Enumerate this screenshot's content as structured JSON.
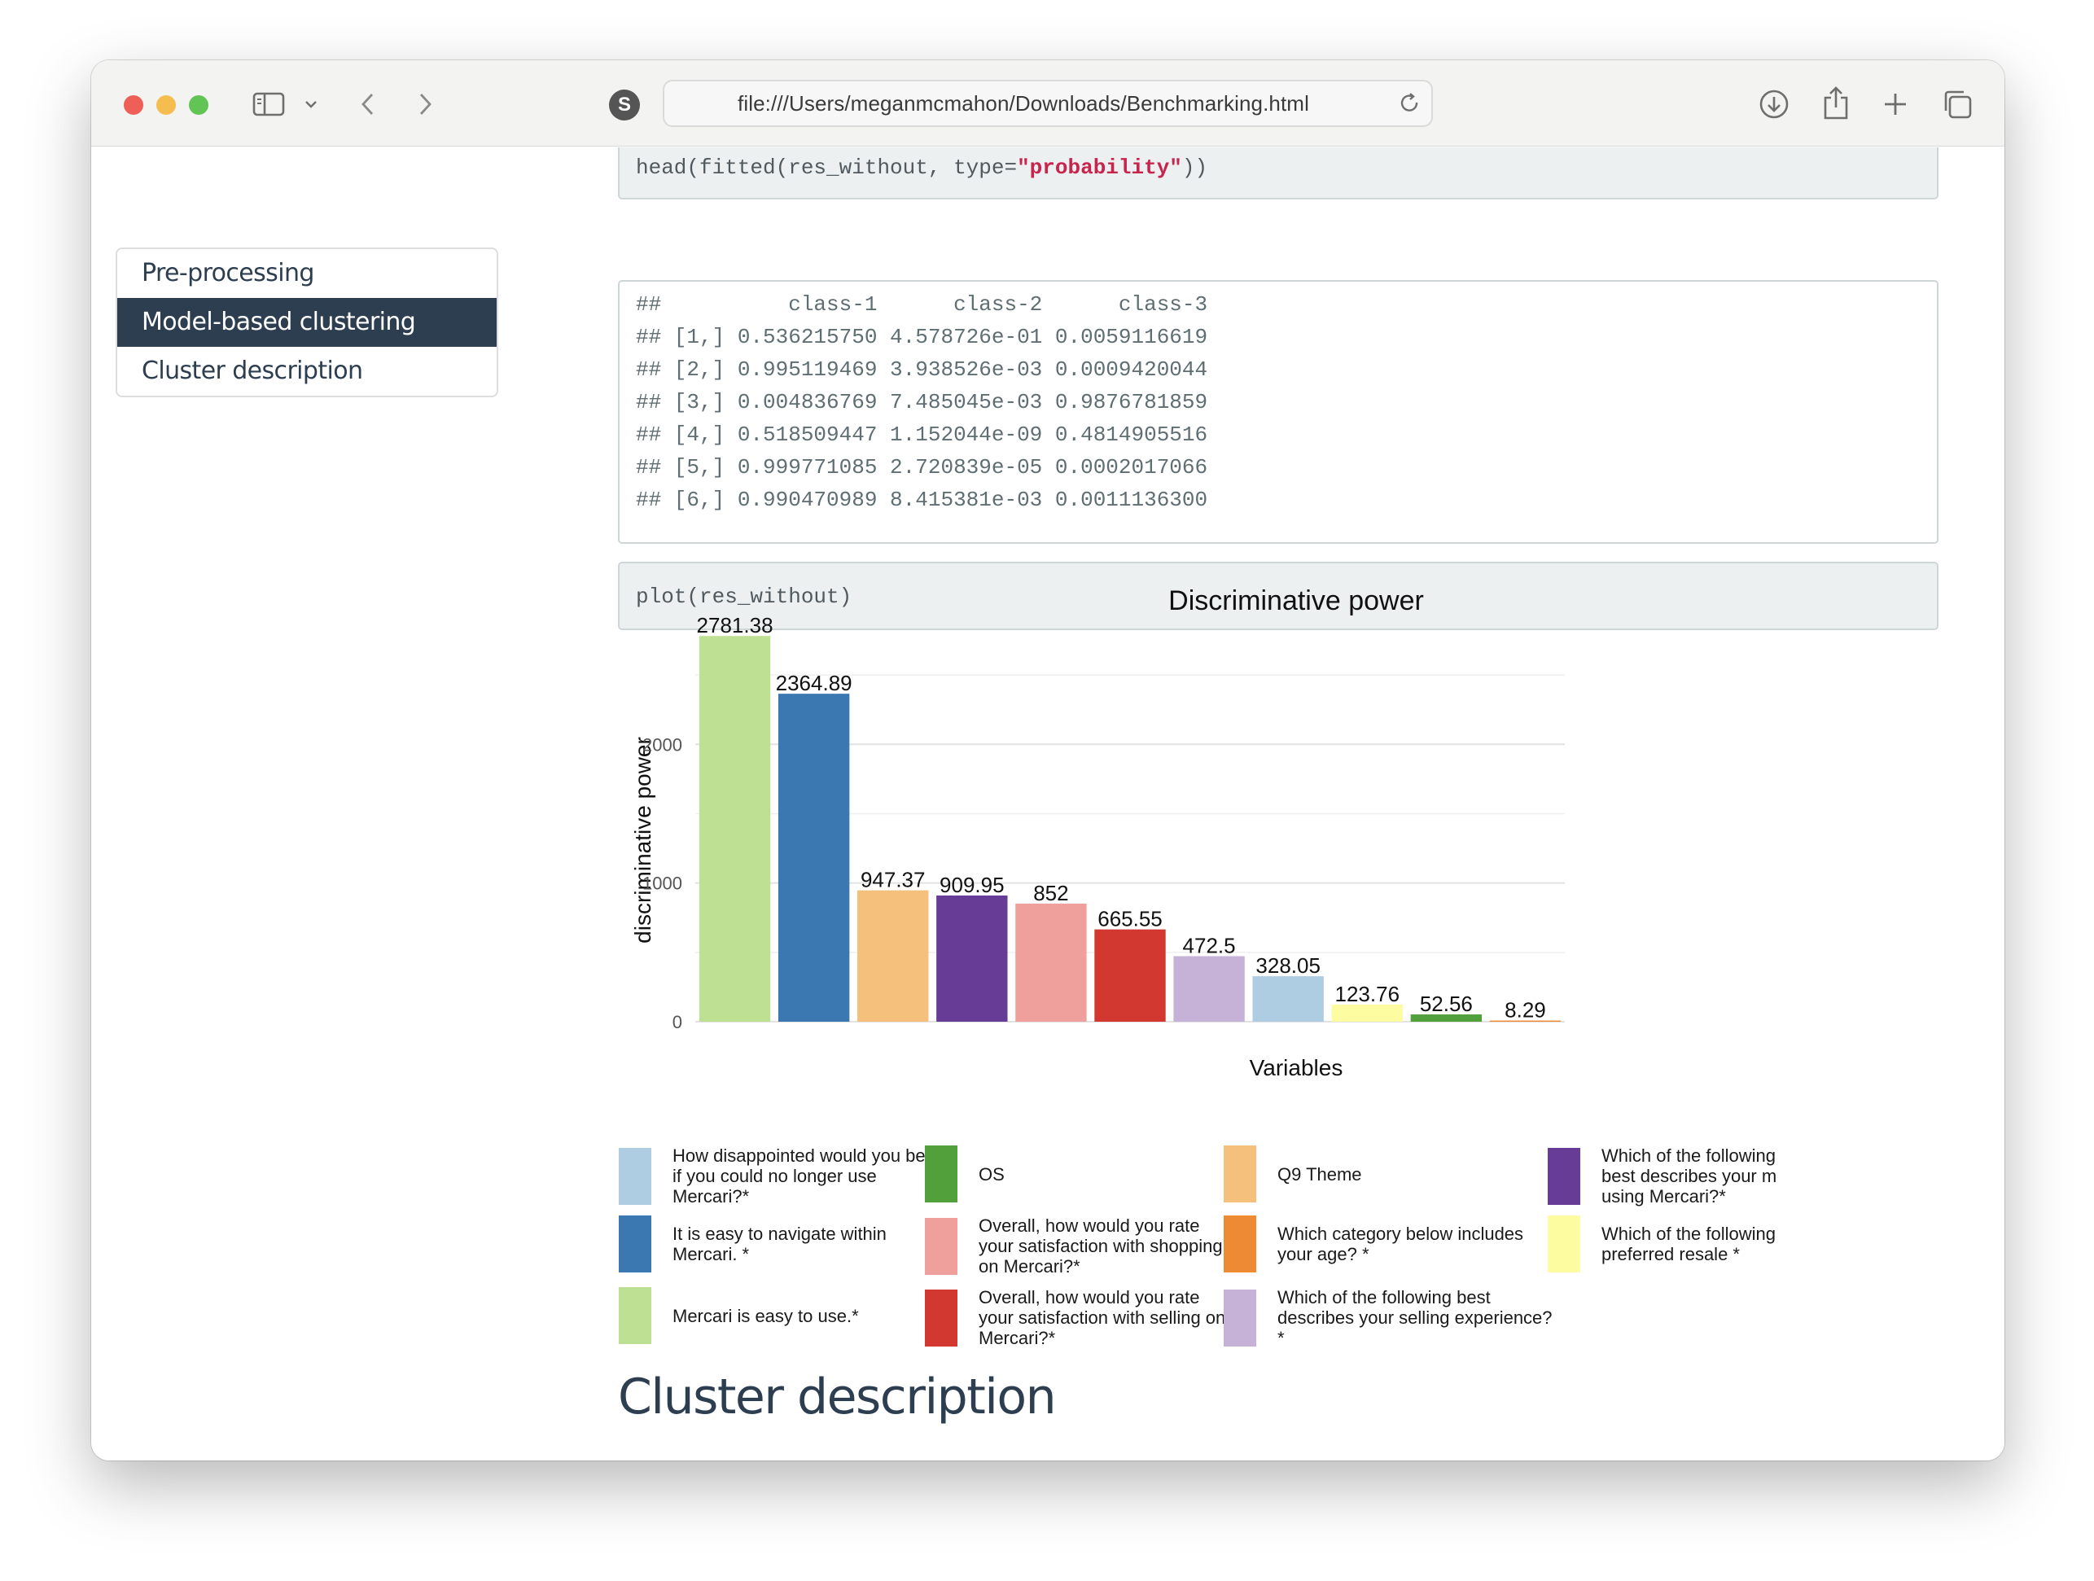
{
  "browser": {
    "url": "file:///Users/meganmcmahon/Downloads/Benchmarking.html",
    "site_badge": "S",
    "icons": [
      "sidebar-icon",
      "chevron-down-icon",
      "back-icon",
      "forward-icon",
      "reload-icon",
      "download-icon",
      "share-icon",
      "new-tab-icon",
      "tabs-overview-icon"
    ]
  },
  "toc": {
    "items": [
      "Pre-processing",
      "Model-based clustering",
      "Cluster description"
    ],
    "active": "Model-based clustering"
  },
  "code1": {
    "prefix": "head(fitted(res_without, type=",
    "string": "\"probability\"",
    "suffix": "))"
  },
  "output": {
    "lines": [
      "##          class-1      class-2      class-3",
      "## [1,] 0.536215750 4.578726e-01 0.0059116619",
      "## [2,] 0.995119469 3.938526e-03 0.0009420044",
      "## [3,] 0.004836769 7.485045e-03 0.9876781859",
      "## [4,] 0.518509447 1.152044e-09 0.4814905516",
      "## [5,] 0.999771085 2.720839e-05 0.0002017066",
      "## [6,] 0.990470989 8.415381e-03 0.0011136300"
    ]
  },
  "code2": {
    "text": "plot(res_without)"
  },
  "chart_data": {
    "type": "bar",
    "title": "Discriminative power",
    "xlabel": "Variables",
    "ylabel": "discriminative power",
    "ylim": [
      0,
      2900
    ],
    "yticks": [
      "0",
      "1000",
      "2000"
    ],
    "grid": true,
    "legend_position": "bottom",
    "values": [
      2781.38,
      2364.89,
      947.37,
      909.95,
      852,
      665.55,
      472.5,
      328.05,
      123.76,
      52.56,
      8.29
    ],
    "value_labels": [
      "2781.38",
      "2364.89",
      "947.37",
      "909.95",
      "852",
      "665.55",
      "472.5",
      "328.05",
      "123.76",
      "52.56",
      "8.29"
    ],
    "colors": [
      "#bde093",
      "#3b77b0",
      "#f4c07c",
      "#663c97",
      "#f0a09c",
      "#d2382f",
      "#c6b2d6",
      "#aecde2",
      "#fefca0",
      "#51a03c",
      "#ee8a33"
    ],
    "legend": [
      {
        "label": "How disappointed would you be if you could no longer use Mercari?*",
        "color": "#aecde2"
      },
      {
        "label": "It is easy to navigate within Mercari. *",
        "color": "#3b77b0"
      },
      {
        "label": "Mercari is easy to use.*",
        "color": "#bde093"
      },
      {
        "label": "OS",
        "color": "#51a03c"
      },
      {
        "label": "Overall, how would you rate your satisfaction with shopping on Mercari?*",
        "color": "#f0a09c"
      },
      {
        "label": "Overall, how would you rate your satisfaction with selling on Mercari?*",
        "color": "#d2382f"
      },
      {
        "label": "Q9 Theme",
        "color": "#f4c07c"
      },
      {
        "label": "Which category below includes your age? *",
        "color": "#ee8a33"
      },
      {
        "label": "Which of the following best describes your selling experience?*",
        "color": "#c6b2d6"
      },
      {
        "label": "Which of the following best describes your m using Mercari?*",
        "color": "#663c97"
      },
      {
        "label": "Which of the following preferred resale *",
        "color": "#fefca0"
      }
    ]
  },
  "section_heading": "Cluster description"
}
